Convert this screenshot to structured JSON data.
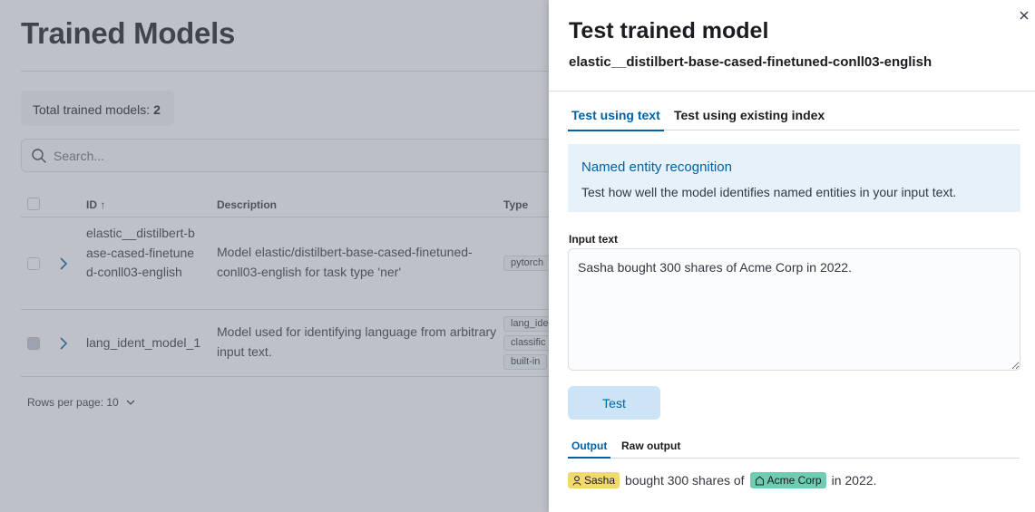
{
  "page": {
    "title": "Trained Models",
    "total_label": "Total trained models: ",
    "total_count": "2",
    "search_placeholder": "Search...",
    "columns": [
      "ID",
      "Description",
      "Type"
    ],
    "rows": [
      {
        "id": "elastic__distilbert-base-cased-finetuned-conll03-english",
        "description": "Model elastic/distilbert-base-cased-finetuned-conll03-english for task type 'ner'",
        "tags": [
          "pytorch"
        ]
      },
      {
        "id": "lang_ident_model_1",
        "description": "Model used for identifying language from arbitrary input text.",
        "tags": [
          "lang_ide",
          "classific",
          "built-in"
        ]
      }
    ],
    "rows_per_page": "Rows per page: 10"
  },
  "flyout": {
    "title": "Test trained model",
    "subtitle": "elastic__distilbert-base-cased-finetuned-conll03-english",
    "tabs": [
      {
        "label": "Test using text",
        "active": true
      },
      {
        "label": "Test using existing index",
        "active": false
      }
    ],
    "callout": {
      "title": "Named entity recognition",
      "text": "Test how well the model identifies named entities in your input text."
    },
    "input_label": "Input text",
    "input_value": "Sasha bought 300 shares of Acme Corp in 2022.",
    "test_button": "Test",
    "output_tabs": [
      {
        "label": "Output",
        "active": true
      },
      {
        "label": "Raw output",
        "active": false
      }
    ],
    "output": {
      "entity_1": "Sasha",
      "entity_1_type": "person-icon",
      "text_1": "bought 300 shares of",
      "entity_2": "Acme Corp",
      "entity_2_type": "building-icon",
      "text_2": "in 2022."
    }
  },
  "colors": {
    "accent": "#0061a6",
    "entity_person": "#f1d86f",
    "entity_org": "#6dccb1"
  }
}
